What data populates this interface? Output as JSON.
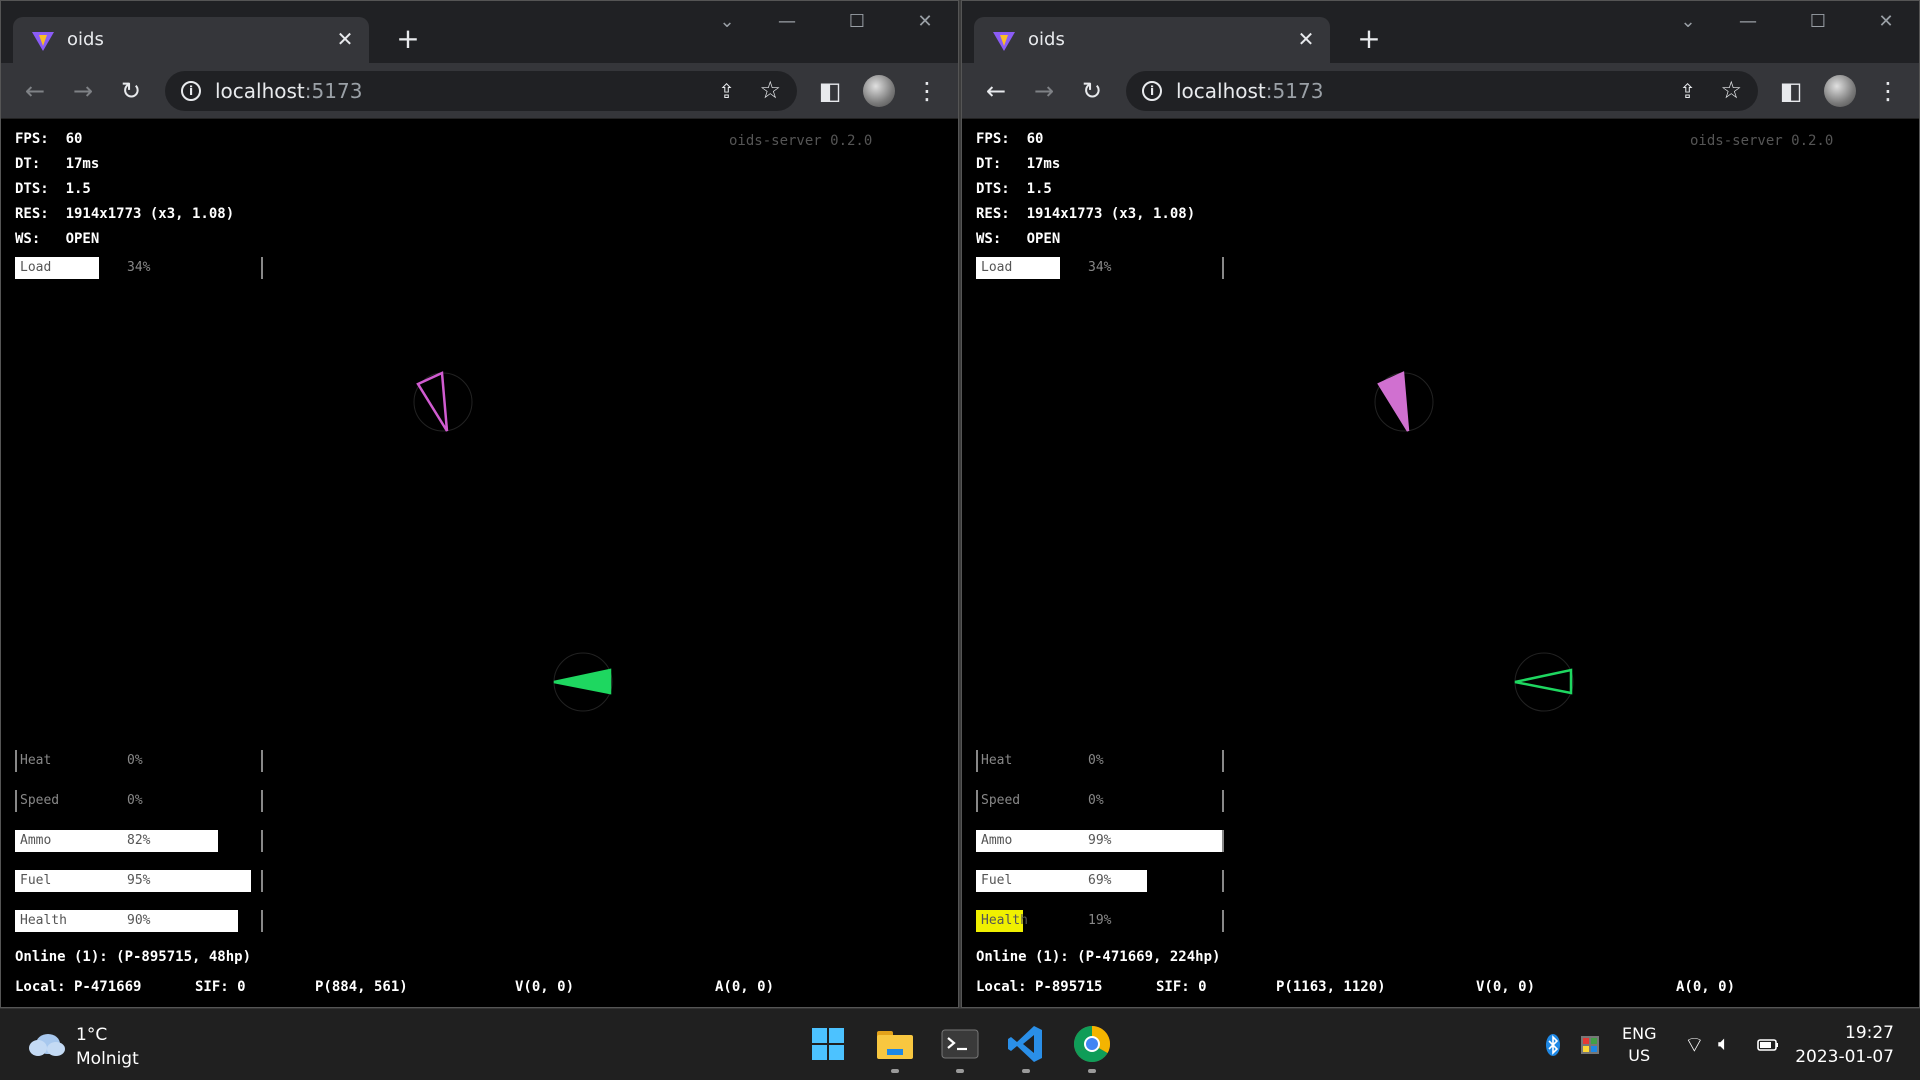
{
  "windows": [
    {
      "tab_title": "oids",
      "url_host": "localhost",
      "url_port": ":5173",
      "server_version": "oids-server 0.2.0",
      "hud": {
        "fps": "FPS:  60",
        "dt": "DT:   17ms",
        "dts": "DTS:  1.5",
        "res": "RES:  1914x1773 (x3, 1.08)",
        "ws": "WS:   OPEN"
      },
      "load_bar": {
        "label": "Load",
        "pct_text": "34%",
        "value": 0.34
      },
      "bars": [
        {
          "label": "Heat",
          "pct_text": "0%",
          "value": 0.0
        },
        {
          "label": "Speed",
          "pct_text": "0%",
          "value": 0.0
        },
        {
          "label": "Ammo",
          "pct_text": "82%",
          "value": 0.82
        },
        {
          "label": "Fuel",
          "pct_text": "95%",
          "value": 0.95
        },
        {
          "label": "Health",
          "pct_text": "90%",
          "value": 0.9
        }
      ],
      "health_warning": false,
      "online": "Online (1): (P-895715, 48hp)",
      "status": {
        "local": "Local: P-471669",
        "sif": "SIF: 0",
        "position": "P(884, 561)",
        "velocity": "V(0, 0)",
        "acceleration": "A(0, 0)"
      },
      "ships": {
        "pink": {
          "color": "#d05bd0",
          "filled": false
        },
        "green": {
          "color": "#1ed760",
          "filled": true
        }
      }
    },
    {
      "tab_title": "oids",
      "url_host": "localhost",
      "url_port": ":5173",
      "server_version": "oids-server 0.2.0",
      "hud": {
        "fps": "FPS:  60",
        "dt": "DT:   17ms",
        "dts": "DTS:  1.5",
        "res": "RES:  1914x1773 (x3, 1.08)",
        "ws": "WS:   OPEN"
      },
      "load_bar": {
        "label": "Load",
        "pct_text": "34%",
        "value": 0.34
      },
      "bars": [
        {
          "label": "Heat",
          "pct_text": "0%",
          "value": 0.0
        },
        {
          "label": "Speed",
          "pct_text": "0%",
          "value": 0.0
        },
        {
          "label": "Ammo",
          "pct_text": "99%",
          "value": 0.99
        },
        {
          "label": "Fuel",
          "pct_text": "69%",
          "value": 0.69
        },
        {
          "label": "Health",
          "pct_text": "19%",
          "value": 0.19
        }
      ],
      "health_warning": true,
      "online": "Online (1): (P-471669, 224hp)",
      "status": {
        "local": "Local: P-895715",
        "sif": "SIF: 0",
        "position": "P(1163, 1120)",
        "velocity": "V(0, 0)",
        "acceleration": "A(0, 0)"
      },
      "ships": {
        "pink": {
          "color": "#d070d0",
          "filled": true
        },
        "green": {
          "color": "#1ed760",
          "filled": false
        }
      }
    }
  ],
  "taskbar": {
    "weather_temp": "1°C",
    "weather_cond": "Molnigt",
    "lang_line1": "ENG",
    "lang_line2": "US",
    "time": "19:27",
    "date": "2023-01-07"
  },
  "colors": {
    "bar_fill": "#ffffff",
    "health_warning": "#f0f000",
    "accent": "#1ed760"
  }
}
